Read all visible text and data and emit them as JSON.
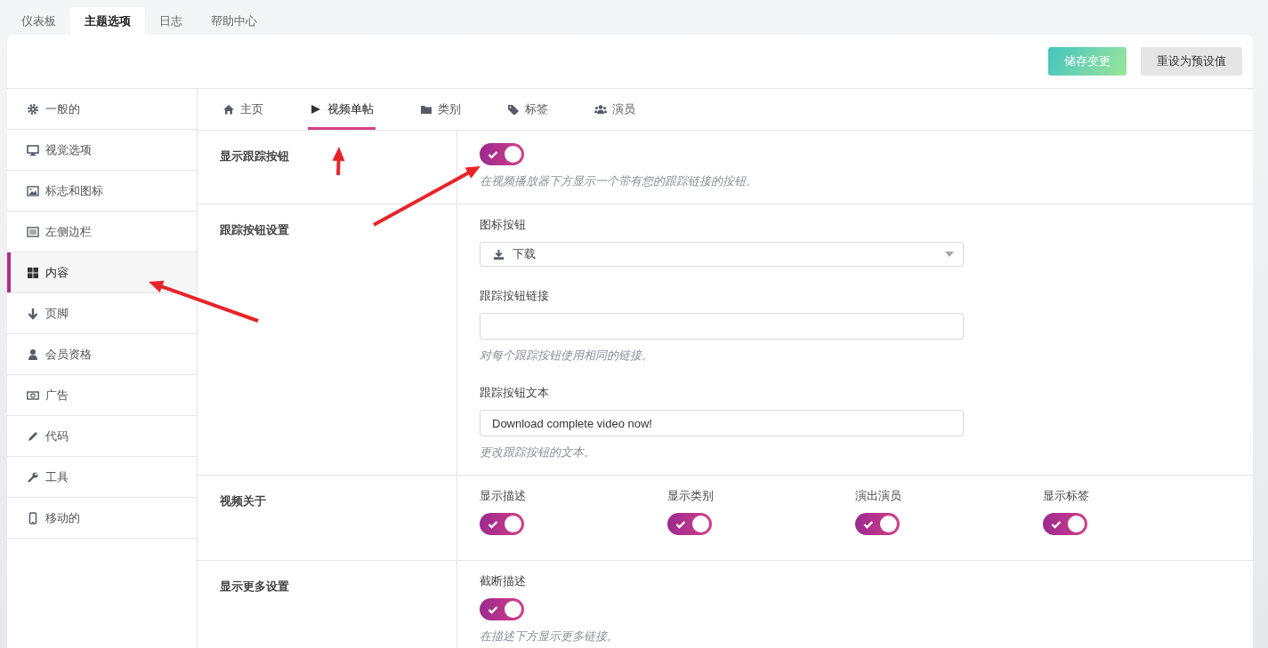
{
  "top_tabs": [
    {
      "label": "仪表板",
      "selected": false
    },
    {
      "label": "主题选项",
      "selected": true
    },
    {
      "label": "日志",
      "selected": false
    },
    {
      "label": "帮助中心",
      "selected": false
    }
  ],
  "header_buttons": [
    {
      "label": "储存变更",
      "kind": "primary"
    },
    {
      "label": "重设为预设值",
      "kind": "secondary"
    }
  ],
  "sidebar": {
    "items": [
      {
        "label": "一般的",
        "selected": false
      },
      {
        "label": "视觉选项",
        "selected": false
      },
      {
        "label": "标志和图标",
        "selected": false
      },
      {
        "label": "左侧边栏",
        "selected": false
      },
      {
        "label": "内容",
        "selected": true
      },
      {
        "label": "页脚",
        "selected": false
      },
      {
        "label": "会员资格",
        "selected": false
      },
      {
        "label": "广告",
        "selected": false
      },
      {
        "label": "代码",
        "selected": false
      },
      {
        "label": "工具",
        "selected": false
      },
      {
        "label": "移动的",
        "selected": false
      }
    ]
  },
  "sub_tabs": [
    {
      "label": "主页",
      "selected": false
    },
    {
      "label": "视频单帖",
      "selected": true
    },
    {
      "label": "类别",
      "selected": false
    },
    {
      "label": "标签",
      "selected": false
    },
    {
      "label": "演员",
      "selected": false
    }
  ],
  "sections": [
    {
      "label": "显示跟踪按钮",
      "kind": "stack",
      "fields": [
        {
          "kind": "toggle",
          "on": true,
          "help": "在视频播放器下方显示一个带有您的跟踪链接的按钮。"
        }
      ]
    },
    {
      "label": "跟踪按钮设置",
      "kind": "stack",
      "fields": [
        {
          "kind": "select",
          "label": "图标按钮",
          "value": "下载"
        },
        {
          "kind": "text",
          "label": "跟踪按钮链接",
          "help": "对每个跟踪按钮使用相同的链接。"
        },
        {
          "kind": "text",
          "label": "跟踪按钮文本",
          "value": "Download complete video now!",
          "help": "更改跟踪按钮的文本。"
        }
      ]
    },
    {
      "label": "视频关于",
      "kind": "columns",
      "fields": [
        {
          "kind": "toggle",
          "label": "显示描述",
          "on": true
        },
        {
          "kind": "toggle",
          "label": "显示类别",
          "on": true
        },
        {
          "kind": "toggle",
          "label": "演出演员",
          "on": true
        },
        {
          "kind": "toggle",
          "label": "显示标签",
          "on": true
        }
      ]
    },
    {
      "label": "显示更多设置",
      "kind": "stack",
      "fields": [
        {
          "kind": "toggle",
          "label": "截断描述",
          "on": true,
          "help": "在描述下方显示更多链接。"
        }
      ]
    }
  ]
}
